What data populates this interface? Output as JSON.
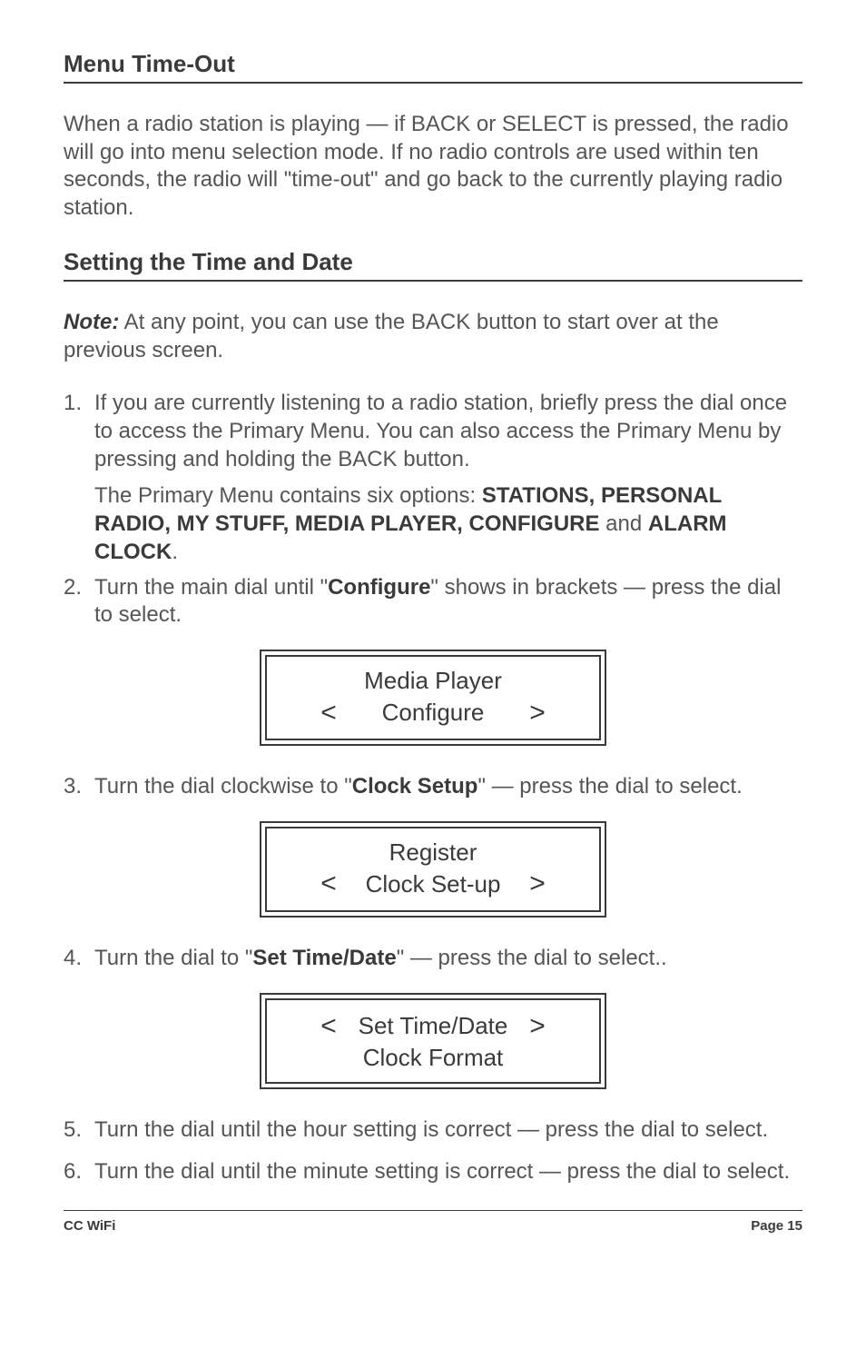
{
  "heading1": "Menu Time-Out",
  "para1": "When a radio station is playing — if BACK or SELECT is pressed, the radio will go into menu selection mode. If no radio controls are used within ten seconds, the radio will \"time-out\" and go back to the currently playing radio station.",
  "heading2": "Setting the Time and Date",
  "note_label": "Note:",
  "note_text": " At any point, you can use the BACK button to start over at the previous screen.",
  "item1_num": "1.",
  "item1_a": "If you are currently listening to a radio station, briefly press the dial once to access the Primary Menu. You can also access the Primary Menu by pressing and holding the BACK button.",
  "item1_b_pre": "The Primary Menu contains six options: ",
  "item1_b_bold1": "STATIONS, PERSONAL RADIO, MY STUFF, MEDIA PLAYER, CONFIGURE",
  "item1_b_mid": " and ",
  "item1_b_bold2": "ALARM CLOCK",
  "item1_b_post": ".",
  "item2_num": "2.",
  "item2_pre": "Turn the main dial until \"",
  "item2_bold": "Configure",
  "item2_post": "\" shows in brackets — press the dial to select.",
  "lcd1": {
    "line1": "Media Player",
    "left": "<",
    "line2": "Configure",
    "right": ">"
  },
  "item3_num": "3.",
  "item3_pre": "Turn the dial clockwise to \"",
  "item3_bold": "Clock Setup",
  "item3_post": "\" — press the dial to select.",
  "lcd2": {
    "line1": "Register",
    "left": "<",
    "line2": "Clock Set-up",
    "right": ">"
  },
  "item4_num": "4.",
  "item4_pre": "Turn the dial to \"",
  "item4_bold": "Set Time/Date",
  "item4_post": "\" — press the dial to select..",
  "lcd3": {
    "left": "<",
    "line1": "Set Time/Date",
    "right": ">",
    "line2": "Clock Format"
  },
  "item5_num": "5.",
  "item5": "Turn the dial until the hour setting is correct — press the dial to select.",
  "item6_num": "6.",
  "item6": "Turn the dial until the minute setting is correct — press the dial to select.",
  "footer_left": "CC WiFi",
  "footer_right": "Page 15"
}
